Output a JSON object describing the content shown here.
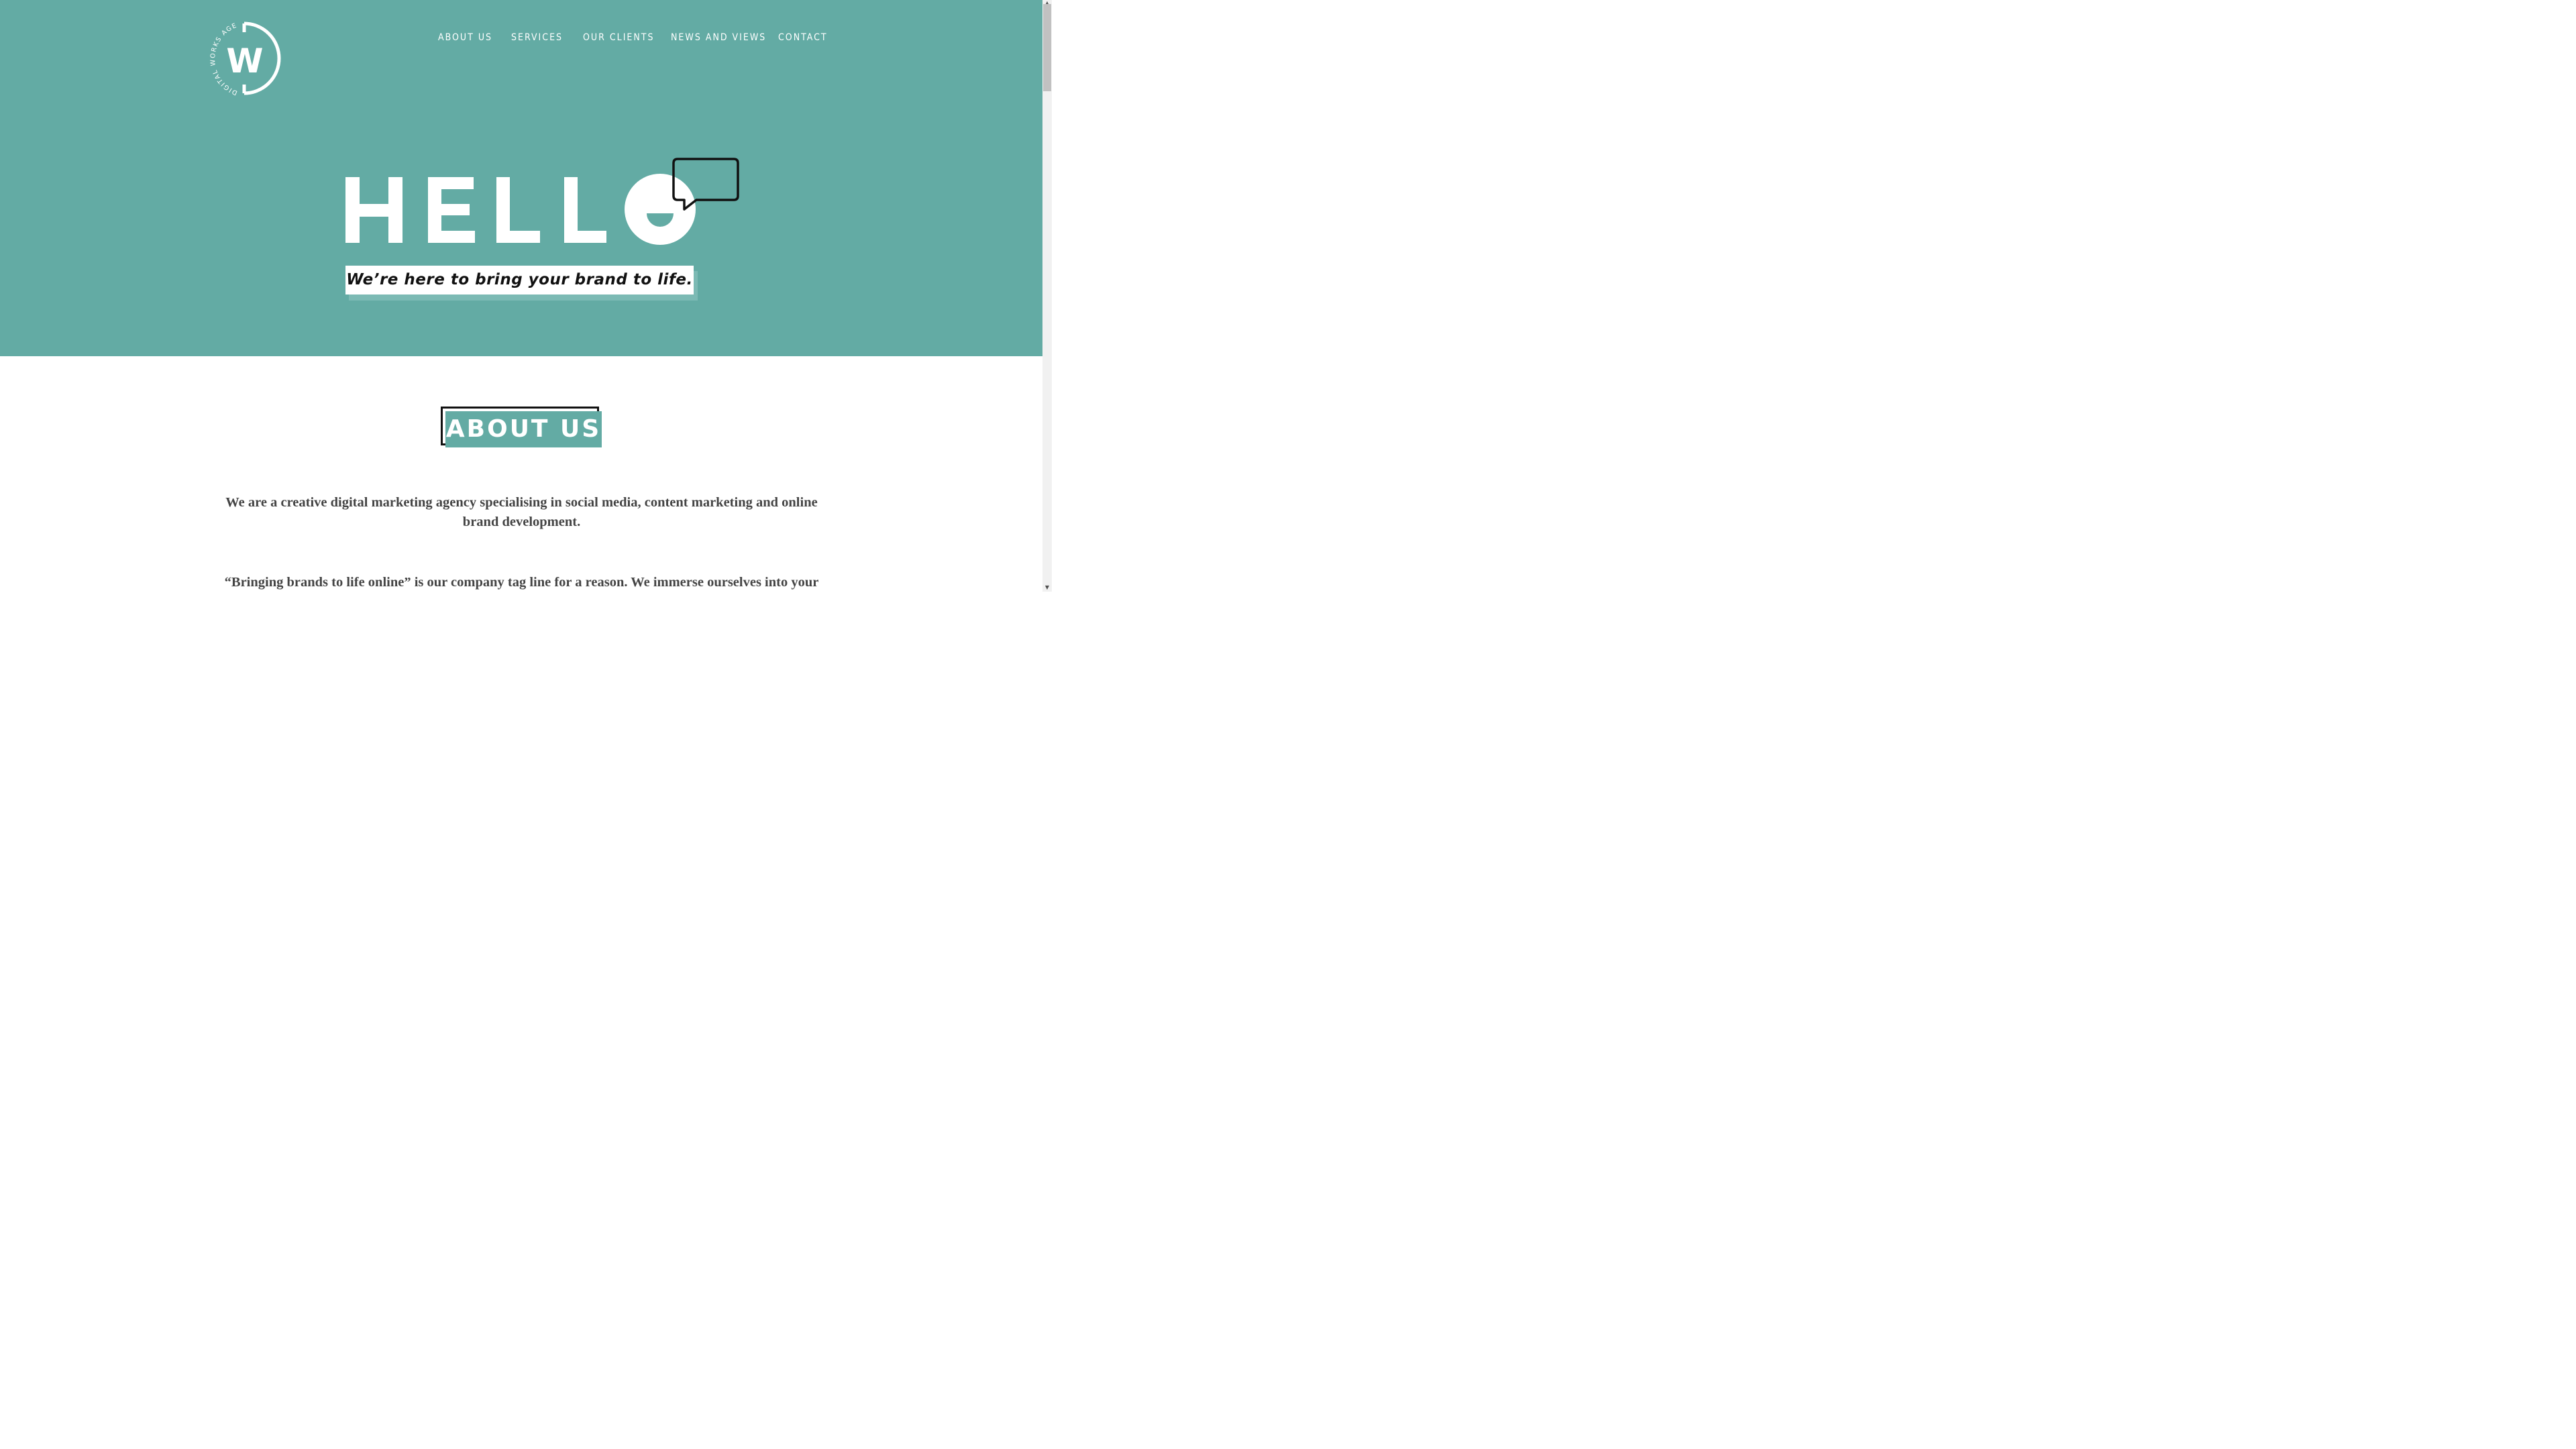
{
  "brand": {
    "logo_letter": "W",
    "logo_ring_text": "DIGITAL WORKS AGENCY",
    "accent_color": "#63aba4"
  },
  "nav": {
    "items": [
      {
        "label": "ABOUT US"
      },
      {
        "label": "SERVICES"
      },
      {
        "label": "OUR CLIENTS"
      },
      {
        "label": "NEWS AND VIEWS"
      },
      {
        "label": "CONTACT"
      }
    ]
  },
  "hero": {
    "headline": "HELLO",
    "tagline": "We’re here to bring your brand to life."
  },
  "about": {
    "title": "ABOUT US",
    "paragraph_1": "We are a creative digital marketing agency specialising in social media, content marketing and online brand development.",
    "paragraph_2": "“Bringing brands to life online” is our company tag line for a reason. We immerse ourselves into your"
  },
  "icons": {
    "speech_bubble": "speech-bubble-icon",
    "scroll_up": "scroll-up-arrow-icon",
    "scroll_down": "scroll-down-arrow-icon"
  }
}
